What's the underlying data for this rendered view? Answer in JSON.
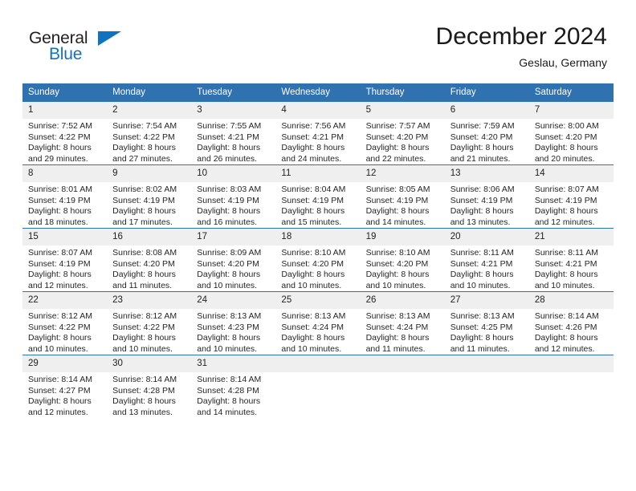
{
  "brand": {
    "name_part1": "General",
    "name_part2": "Blue",
    "accent_color": "#1272bb"
  },
  "header": {
    "title": "December 2024",
    "subtitle": "Geslau, Germany"
  },
  "calendar": {
    "header_color": "#3071b0",
    "daynum_band_color": "#efefef",
    "weekdays": [
      "Sunday",
      "Monday",
      "Tuesday",
      "Wednesday",
      "Thursday",
      "Friday",
      "Saturday"
    ],
    "weeks": [
      [
        {
          "day": "1",
          "sunrise": "Sunrise: 7:52 AM",
          "sunset": "Sunset: 4:22 PM",
          "daylight1": "Daylight: 8 hours",
          "daylight2": "and 29 minutes."
        },
        {
          "day": "2",
          "sunrise": "Sunrise: 7:54 AM",
          "sunset": "Sunset: 4:22 PM",
          "daylight1": "Daylight: 8 hours",
          "daylight2": "and 27 minutes."
        },
        {
          "day": "3",
          "sunrise": "Sunrise: 7:55 AM",
          "sunset": "Sunset: 4:21 PM",
          "daylight1": "Daylight: 8 hours",
          "daylight2": "and 26 minutes."
        },
        {
          "day": "4",
          "sunrise": "Sunrise: 7:56 AM",
          "sunset": "Sunset: 4:21 PM",
          "daylight1": "Daylight: 8 hours",
          "daylight2": "and 24 minutes."
        },
        {
          "day": "5",
          "sunrise": "Sunrise: 7:57 AM",
          "sunset": "Sunset: 4:20 PM",
          "daylight1": "Daylight: 8 hours",
          "daylight2": "and 22 minutes."
        },
        {
          "day": "6",
          "sunrise": "Sunrise: 7:59 AM",
          "sunset": "Sunset: 4:20 PM",
          "daylight1": "Daylight: 8 hours",
          "daylight2": "and 21 minutes."
        },
        {
          "day": "7",
          "sunrise": "Sunrise: 8:00 AM",
          "sunset": "Sunset: 4:20 PM",
          "daylight1": "Daylight: 8 hours",
          "daylight2": "and 20 minutes."
        }
      ],
      [
        {
          "day": "8",
          "sunrise": "Sunrise: 8:01 AM",
          "sunset": "Sunset: 4:19 PM",
          "daylight1": "Daylight: 8 hours",
          "daylight2": "and 18 minutes."
        },
        {
          "day": "9",
          "sunrise": "Sunrise: 8:02 AM",
          "sunset": "Sunset: 4:19 PM",
          "daylight1": "Daylight: 8 hours",
          "daylight2": "and 17 minutes."
        },
        {
          "day": "10",
          "sunrise": "Sunrise: 8:03 AM",
          "sunset": "Sunset: 4:19 PM",
          "daylight1": "Daylight: 8 hours",
          "daylight2": "and 16 minutes."
        },
        {
          "day": "11",
          "sunrise": "Sunrise: 8:04 AM",
          "sunset": "Sunset: 4:19 PM",
          "daylight1": "Daylight: 8 hours",
          "daylight2": "and 15 minutes."
        },
        {
          "day": "12",
          "sunrise": "Sunrise: 8:05 AM",
          "sunset": "Sunset: 4:19 PM",
          "daylight1": "Daylight: 8 hours",
          "daylight2": "and 14 minutes."
        },
        {
          "day": "13",
          "sunrise": "Sunrise: 8:06 AM",
          "sunset": "Sunset: 4:19 PM",
          "daylight1": "Daylight: 8 hours",
          "daylight2": "and 13 minutes."
        },
        {
          "day": "14",
          "sunrise": "Sunrise: 8:07 AM",
          "sunset": "Sunset: 4:19 PM",
          "daylight1": "Daylight: 8 hours",
          "daylight2": "and 12 minutes."
        }
      ],
      [
        {
          "day": "15",
          "sunrise": "Sunrise: 8:07 AM",
          "sunset": "Sunset: 4:19 PM",
          "daylight1": "Daylight: 8 hours",
          "daylight2": "and 12 minutes."
        },
        {
          "day": "16",
          "sunrise": "Sunrise: 8:08 AM",
          "sunset": "Sunset: 4:20 PM",
          "daylight1": "Daylight: 8 hours",
          "daylight2": "and 11 minutes."
        },
        {
          "day": "17",
          "sunrise": "Sunrise: 8:09 AM",
          "sunset": "Sunset: 4:20 PM",
          "daylight1": "Daylight: 8 hours",
          "daylight2": "and 10 minutes."
        },
        {
          "day": "18",
          "sunrise": "Sunrise: 8:10 AM",
          "sunset": "Sunset: 4:20 PM",
          "daylight1": "Daylight: 8 hours",
          "daylight2": "and 10 minutes."
        },
        {
          "day": "19",
          "sunrise": "Sunrise: 8:10 AM",
          "sunset": "Sunset: 4:20 PM",
          "daylight1": "Daylight: 8 hours",
          "daylight2": "and 10 minutes."
        },
        {
          "day": "20",
          "sunrise": "Sunrise: 8:11 AM",
          "sunset": "Sunset: 4:21 PM",
          "daylight1": "Daylight: 8 hours",
          "daylight2": "and 10 minutes."
        },
        {
          "day": "21",
          "sunrise": "Sunrise: 8:11 AM",
          "sunset": "Sunset: 4:21 PM",
          "daylight1": "Daylight: 8 hours",
          "daylight2": "and 10 minutes."
        }
      ],
      [
        {
          "day": "22",
          "sunrise": "Sunrise: 8:12 AM",
          "sunset": "Sunset: 4:22 PM",
          "daylight1": "Daylight: 8 hours",
          "daylight2": "and 10 minutes."
        },
        {
          "day": "23",
          "sunrise": "Sunrise: 8:12 AM",
          "sunset": "Sunset: 4:22 PM",
          "daylight1": "Daylight: 8 hours",
          "daylight2": "and 10 minutes."
        },
        {
          "day": "24",
          "sunrise": "Sunrise: 8:13 AM",
          "sunset": "Sunset: 4:23 PM",
          "daylight1": "Daylight: 8 hours",
          "daylight2": "and 10 minutes."
        },
        {
          "day": "25",
          "sunrise": "Sunrise: 8:13 AM",
          "sunset": "Sunset: 4:24 PM",
          "daylight1": "Daylight: 8 hours",
          "daylight2": "and 10 minutes."
        },
        {
          "day": "26",
          "sunrise": "Sunrise: 8:13 AM",
          "sunset": "Sunset: 4:24 PM",
          "daylight1": "Daylight: 8 hours",
          "daylight2": "and 11 minutes."
        },
        {
          "day": "27",
          "sunrise": "Sunrise: 8:13 AM",
          "sunset": "Sunset: 4:25 PM",
          "daylight1": "Daylight: 8 hours",
          "daylight2": "and 11 minutes."
        },
        {
          "day": "28",
          "sunrise": "Sunrise: 8:14 AM",
          "sunset": "Sunset: 4:26 PM",
          "daylight1": "Daylight: 8 hours",
          "daylight2": "and 12 minutes."
        }
      ],
      [
        {
          "day": "29",
          "sunrise": "Sunrise: 8:14 AM",
          "sunset": "Sunset: 4:27 PM",
          "daylight1": "Daylight: 8 hours",
          "daylight2": "and 12 minutes."
        },
        {
          "day": "30",
          "sunrise": "Sunrise: 8:14 AM",
          "sunset": "Sunset: 4:28 PM",
          "daylight1": "Daylight: 8 hours",
          "daylight2": "and 13 minutes."
        },
        {
          "day": "31",
          "sunrise": "Sunrise: 8:14 AM",
          "sunset": "Sunset: 4:28 PM",
          "daylight1": "Daylight: 8 hours",
          "daylight2": "and 14 minutes."
        },
        {
          "day": "",
          "sunrise": "",
          "sunset": "",
          "daylight1": "",
          "daylight2": ""
        },
        {
          "day": "",
          "sunrise": "",
          "sunset": "",
          "daylight1": "",
          "daylight2": ""
        },
        {
          "day": "",
          "sunrise": "",
          "sunset": "",
          "daylight1": "",
          "daylight2": ""
        },
        {
          "day": "",
          "sunrise": "",
          "sunset": "",
          "daylight1": "",
          "daylight2": ""
        }
      ]
    ]
  }
}
